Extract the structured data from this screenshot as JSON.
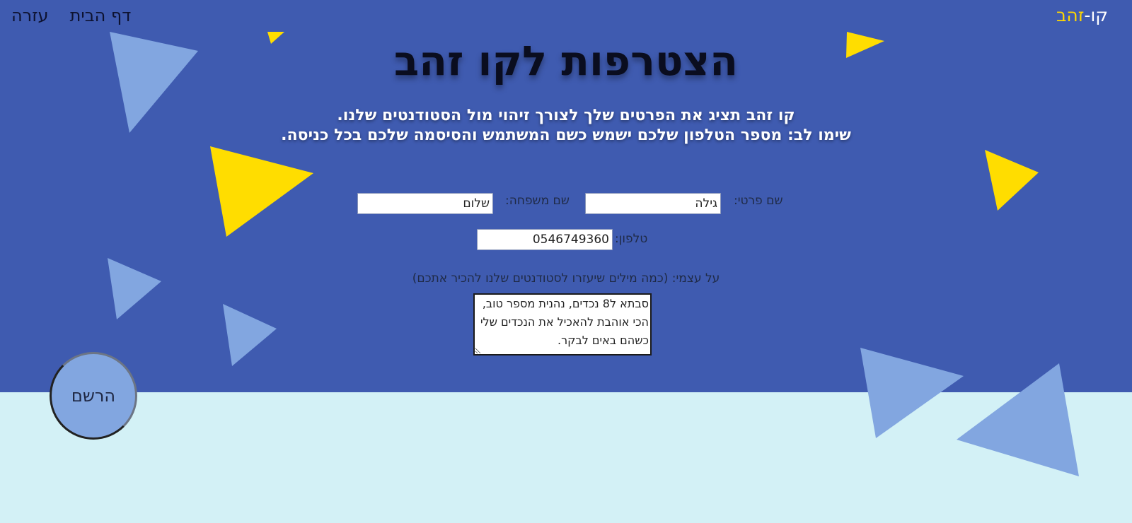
{
  "brand": {
    "part1": "קו-",
    "part2": "זהב"
  },
  "nav": {
    "home": "דף הבית",
    "help": "עזרה"
  },
  "page": {
    "title": "הצטרפות לקו זהב",
    "subtitle_line1": "קו זהב תציג את הפרטים שלך לצורך זיהוי מול הסטודנטים שלנו.",
    "subtitle_line2": "שימו לב: מספר הטלפון שלכם ישמש כשם המשתמש והסיסמה שלכם בכל כניסה."
  },
  "form": {
    "first_name_label": "שם פרטי:",
    "first_name_value": "גילה",
    "last_name_label": "שם משפחה:",
    "last_name_value": "שלום",
    "phone_label": "טלפון:",
    "phone_value": "0546749360",
    "about_label": "על עצמי: (כמה מילים שיעזרו לסטודנטים שלנו להכיר אתכם)",
    "about_value": "סבתא ל8 נכדים, נהנית מספר טוב, הכי אוהבת להאכיל את הנכדים שלי כשהם באים לבקר.",
    "register_label": "הרשם"
  },
  "colors": {
    "hero_background": "#3f5bb0",
    "bottom_background": "#d3f1f6",
    "accent_yellow": "#ffdd00",
    "light_triangle": "#82a6e0",
    "brand_gold": "#ffd700"
  }
}
